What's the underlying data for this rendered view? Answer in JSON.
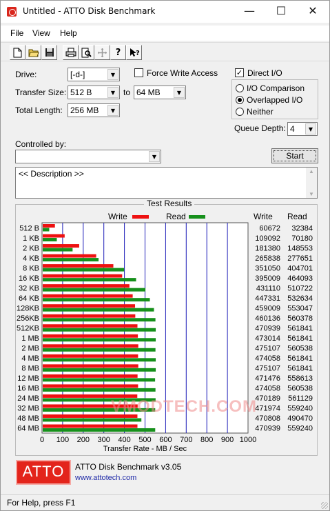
{
  "window": {
    "title": "Untitled - ATTO Disk Benchmark"
  },
  "menu": [
    "File",
    "View",
    "Help"
  ],
  "toolbar": {
    "icons": [
      "new-icon",
      "open-icon",
      "save-icon",
      "print-icon",
      "print-preview-icon",
      "move-icon",
      "help-icon",
      "context-help-icon"
    ]
  },
  "settings": {
    "drive_label": "Drive:",
    "drive_value": "[-d-]",
    "force_write_label": "Force Write Access",
    "force_write_checked": false,
    "direct_io_label": "Direct I/O",
    "direct_io_checked": true,
    "transfer_size_label": "Transfer Size:",
    "transfer_from": "512 B",
    "to_label": "to",
    "transfer_to": "64 MB",
    "total_length_label": "Total Length:",
    "total_length_value": "256 MB",
    "io_comparison_label": "I/O Comparison",
    "overlapped_io_label": "Overlapped I/O",
    "neither_label": "Neither",
    "selected_mode": "Overlapped I/O",
    "queue_depth_label": "Queue Depth:",
    "queue_depth_value": "4",
    "controlled_by_label": "Controlled by:",
    "controlled_by_value": "",
    "start_label": "Start",
    "description": "<< Description >>"
  },
  "results": {
    "title": "Test Results",
    "write_legend": "Write",
    "read_legend": "Read",
    "write_header": "Write",
    "read_header": "Read"
  },
  "colors": {
    "write": "#ee1111",
    "read": "#16901b",
    "grid": "#1b1bb8"
  },
  "watermark": "VMODTECH.COM",
  "chart_data": {
    "type": "bar",
    "orientation": "horizontal",
    "title": "Test Results",
    "xlabel": "Transfer Rate - MB / Sec",
    "xlim": [
      0,
      1000
    ],
    "xticks": [
      "0",
      "100",
      "200",
      "300",
      "400",
      "500",
      "600",
      "700",
      "800",
      "900",
      "1000"
    ],
    "categories": [
      "512 B",
      "1 KB",
      "2 KB",
      "4 KB",
      "8 KB",
      "16 KB",
      "32 KB",
      "64 KB",
      "128KB",
      "256KB",
      "512KB",
      "1 MB",
      "2 MB",
      "4 MB",
      "8 MB",
      "12 MB",
      "16 MB",
      "24 MB",
      "32 MB",
      "48 MB",
      "64 MB"
    ],
    "series": [
      {
        "name": "Write",
        "values": [
          60672,
          109092,
          181380,
          265838,
          351050,
          395009,
          431110,
          447331,
          459009,
          460136,
          470939,
          473014,
          475107,
          474058,
          475107,
          471476,
          474058,
          470189,
          471974,
          470808,
          470939
        ]
      },
      {
        "name": "Read",
        "values": [
          32384,
          70180,
          148553,
          277651,
          404701,
          464093,
          510722,
          532634,
          553047,
          560378,
          561841,
          561841,
          560538,
          561841,
          561841,
          558613,
          560538,
          561129,
          559240,
          490470,
          559240
        ]
      }
    ],
    "legend": "top",
    "grid": true
  },
  "about": {
    "logo": "ATTO",
    "version": "ATTO Disk Benchmark v3.05",
    "website": "www.attotech.com"
  },
  "status": "For Help, press F1"
}
